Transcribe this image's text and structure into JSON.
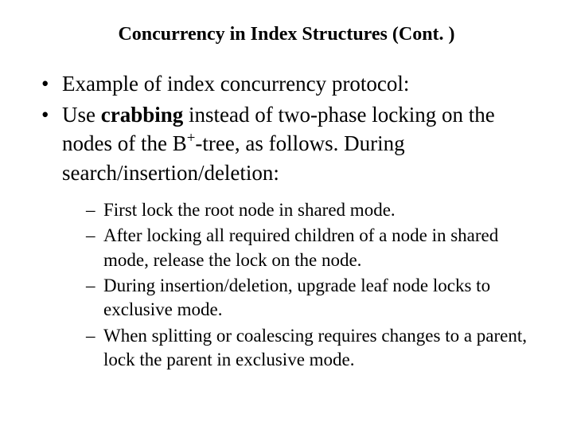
{
  "title": "Concurrency in Index Structures (Cont. )",
  "bullets": [
    {
      "text": "Example of index concurrency protocol:"
    },
    {
      "pre": "Use ",
      "bold": "crabbing",
      "mid": " instead of two-phase locking on the nodes of the B",
      "sup": "+",
      "post": "-tree, as follows. During search/insertion/deletion:"
    }
  ],
  "subbullets": [
    "First lock the root node in shared mode.",
    "After locking all required children of a node in shared mode, release the lock on the node.",
    "During insertion/deletion, upgrade leaf node locks to exclusive mode.",
    "When splitting or coalescing requires changes to a parent, lock the parent in exclusive mode."
  ]
}
